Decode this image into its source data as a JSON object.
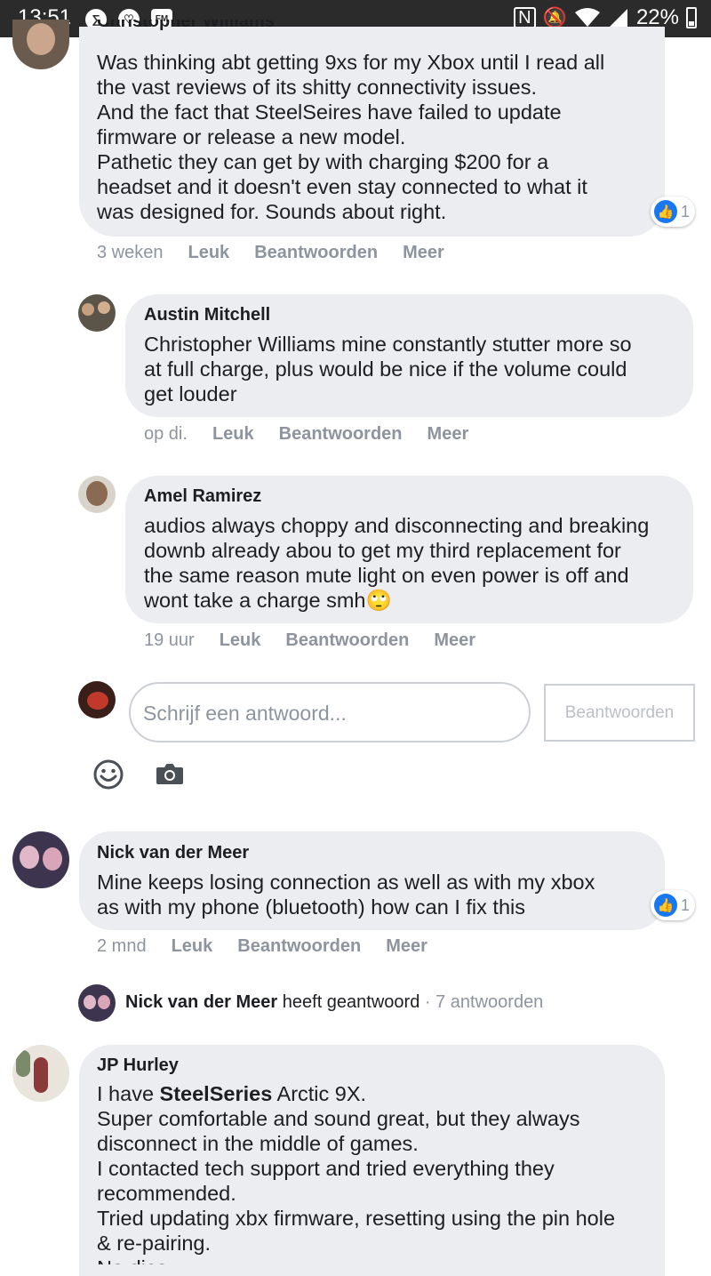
{
  "status_bar": {
    "time": "13:51",
    "fm_label": "FM",
    "battery": "22%"
  },
  "colors": {
    "bubble": "#ebedf0",
    "accent": "#1877f2",
    "muted": "#8d949e"
  },
  "comments": {
    "c1": {
      "author_partial": "Christopher Williams",
      "text": "Was thinking abt getting 9xs for my Xbox until I read all\nthe vast reviews of its shitty connectivity issues.\nAnd the fact that SteelSeires have failed to update\nfirmware or release a new model.\nPathetic they can get by with charging $200 for a\nheadset and it doesn't even stay connected to what it\nwas designed for. Sounds about right.",
      "likes": "1",
      "time": "3 weken"
    },
    "r1": {
      "author": "Austin Mitchell",
      "text": "Christopher Williams mine constantly stutter more so\nat full charge, plus would be nice if the volume could\nget louder",
      "time": "op di."
    },
    "r2": {
      "author": "Amel Ramirez",
      "text": "audios always choppy and disconnecting and breaking\ndownb already abou to get my third replacement for\nthe same reason mute light on even power is off and\nwont take a charge smh",
      "emoji": "🙄",
      "time": "19 uur"
    },
    "c2": {
      "author": "Nick van der Meer",
      "text": "Mine keeps losing connection as well as with my xbox\nas with my phone (bluetooth) how can I fix this",
      "likes": "1",
      "time": "2 mnd"
    },
    "c2_replies": {
      "author": "Nick van der Meer",
      "action": "heeft geantwoord",
      "count": "· 7 antwoorden"
    },
    "c3": {
      "author": "JP Hurley",
      "text_prefix": "I have ",
      "text_bold": "SteelSeries",
      "text_suffix": " Arctic 9X.",
      "text_rest": "Super comfortable and sound great, but they always\ndisconnect in the middle of games.\nI contacted tech support and tried everything they\nrecommended.\nTried updating xbx firmware, resetting using the pin hole\n& re-pairing.",
      "text_cut": "No dice."
    }
  },
  "actions": {
    "like": "Leuk",
    "reply": "Beantwoorden",
    "more": "Meer"
  },
  "reply_box": {
    "placeholder": "Schrijf een antwoord...",
    "button": "Beantwoorden"
  },
  "icons": {
    "emoji": "emoji-icon",
    "camera": "camera-icon",
    "like": "thumbs-up-icon"
  }
}
